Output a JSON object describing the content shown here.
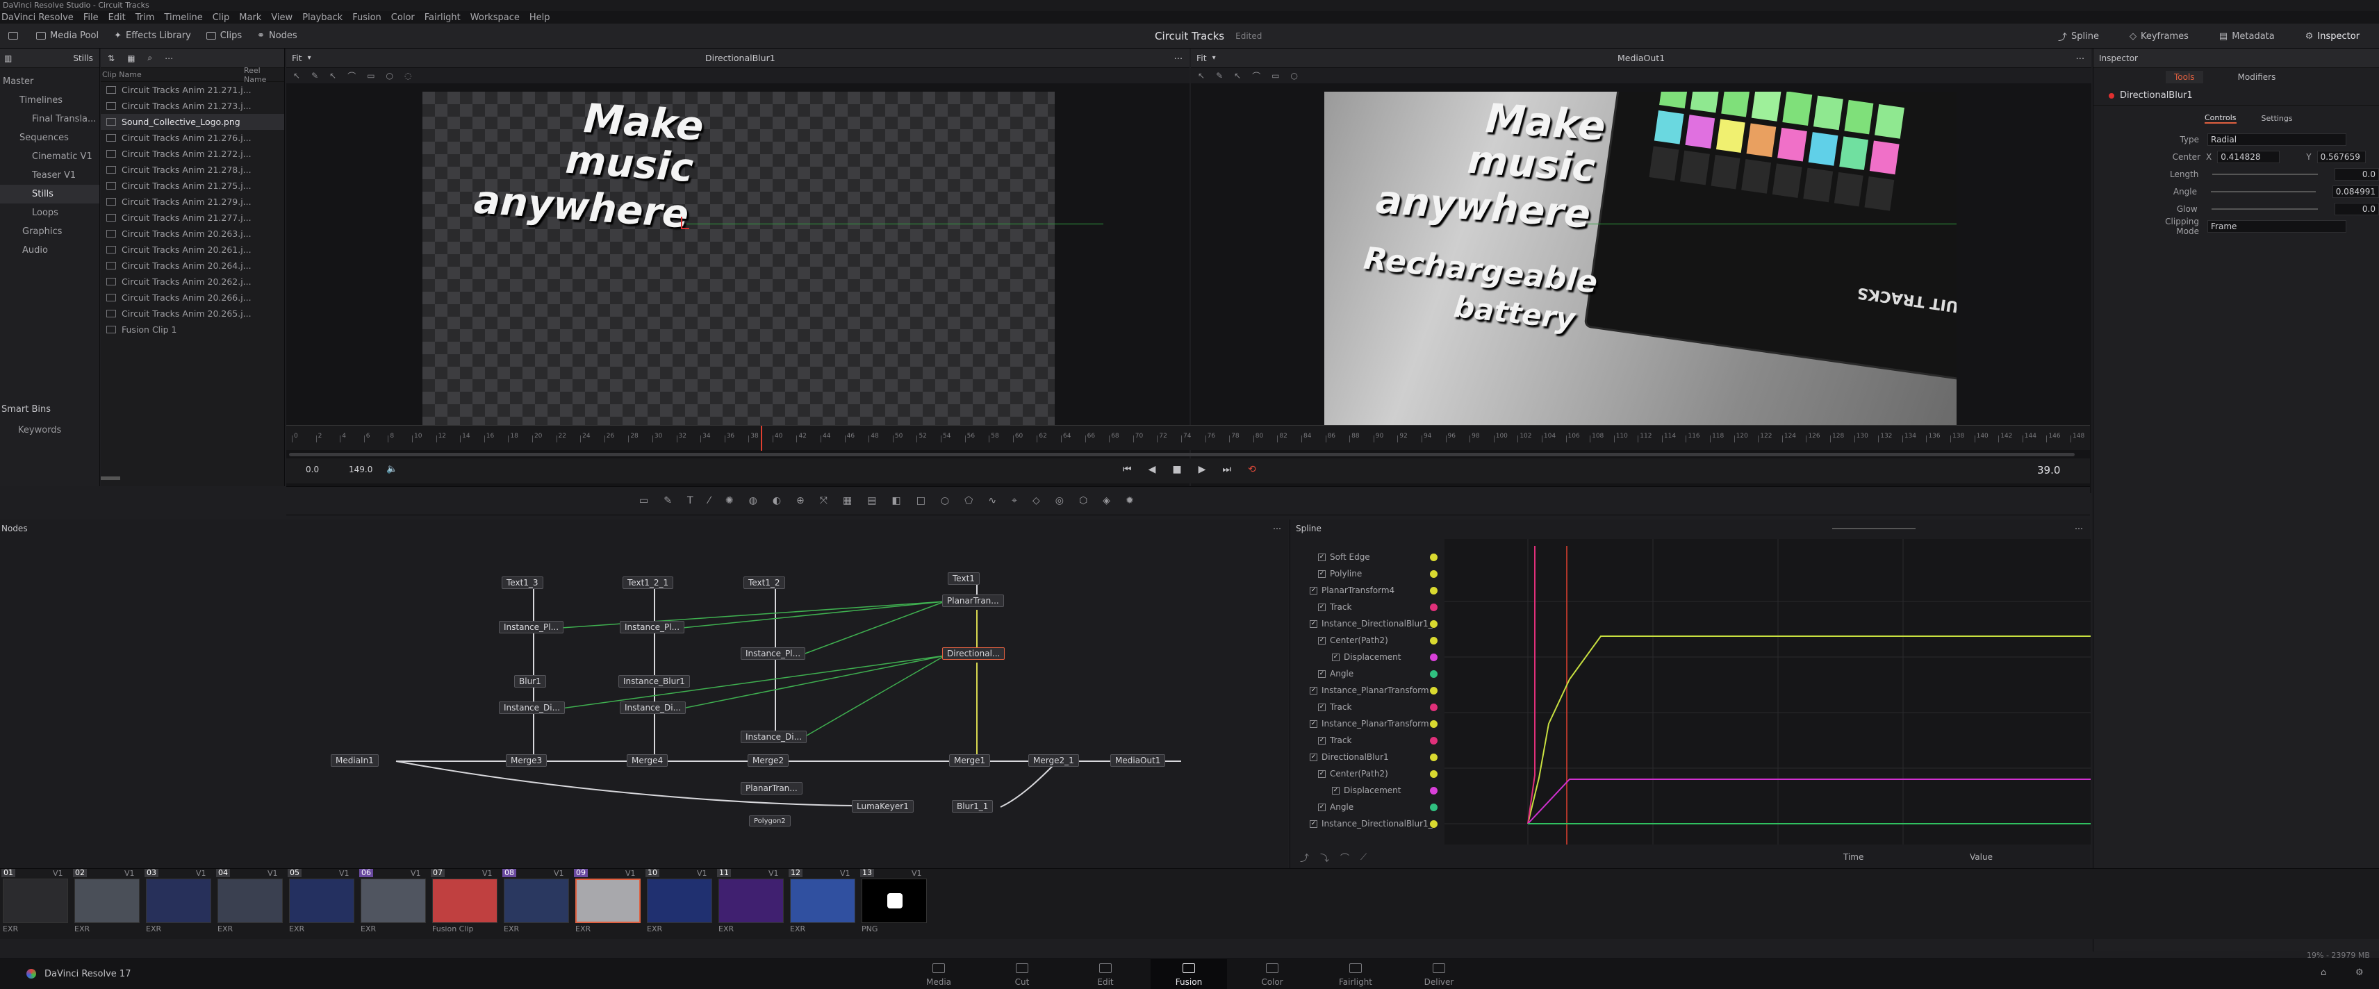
{
  "window": {
    "title": "DaVinci Resolve Studio - Circuit Tracks"
  },
  "menu": [
    "DaVinci Resolve",
    "File",
    "Edit",
    "Trim",
    "Timeline",
    "Clip",
    "Mark",
    "View",
    "Playback",
    "Fusion",
    "Color",
    "Fairlight",
    "Workspace",
    "Help"
  ],
  "toolbar": {
    "media_pool": "Media Pool",
    "effects_library": "Effects Library",
    "clips": "Clips",
    "nodes": "Nodes",
    "project_name": "Circuit Tracks",
    "edited": "Edited",
    "spline": "Spline",
    "keyframes": "Keyframes",
    "metadata": "Metadata",
    "inspector": "Inspector"
  },
  "media_pool": {
    "stills_label": "Stills",
    "tree": [
      "Master",
      "Timelines",
      "Final Transla...",
      "Sequences",
      "Cinematic V1",
      "Teaser V1",
      "Stills",
      "Loops",
      "Graphics",
      "Audio"
    ],
    "smart_bins": "Smart Bins",
    "keywords": "Keywords",
    "col_clip_name": "Clip Name",
    "col_reel_name": "Reel Name",
    "clips": [
      "Circuit Tracks Anim 21.271.j...",
      "Circuit Tracks Anim 21.273.j...",
      "Sound_Collective_Logo.png",
      "Circuit Tracks Anim 21.276.j...",
      "Circuit Tracks Anim 21.272.j...",
      "Circuit Tracks Anim 21.278.j...",
      "Circuit Tracks Anim 21.275.j...",
      "Circuit Tracks Anim 21.279.j...",
      "Circuit Tracks Anim 21.277.j...",
      "Circuit Tracks Anim 20.263.j...",
      "Circuit Tracks Anim 20.261.j...",
      "Circuit Tracks Anim 20.264.j...",
      "Circuit Tracks Anim 20.262.j...",
      "Circuit Tracks Anim 20.266.j...",
      "Circuit Tracks Anim 20.265.j...",
      "Fusion Clip 1"
    ]
  },
  "viewer_left": {
    "zoom": "Fit",
    "title": "DirectionalBlur1",
    "text1": "Make",
    "text2": "music",
    "text3": "anywhere"
  },
  "viewer_right": {
    "zoom": "Fit",
    "title": "MediaOut1",
    "text1": "Make",
    "text2": "music",
    "text3": "anywhere",
    "text4": "Rechargeable",
    "text5": "battery",
    "device_label": "UIT TRACKS"
  },
  "ruler": {
    "ticks": [
      "0",
      "2",
      "4",
      "6",
      "8",
      "10",
      "12",
      "14",
      "16",
      "18",
      "20",
      "22",
      "24",
      "26",
      "28",
      "30",
      "32",
      "34",
      "36",
      "38",
      "40",
      "42",
      "44",
      "46",
      "48",
      "50",
      "52",
      "54",
      "56",
      "58",
      "60",
      "62",
      "64",
      "66",
      "68",
      "70",
      "72",
      "74",
      "76",
      "78",
      "80",
      "82",
      "84",
      "86",
      "88",
      "90",
      "92",
      "94",
      "96",
      "98",
      "100",
      "102",
      "104",
      "106",
      "108",
      "110",
      "112",
      "114",
      "116",
      "118",
      "120",
      "122",
      "124",
      "126",
      "128",
      "130",
      "132",
      "134",
      "136",
      "138",
      "140",
      "142",
      "144",
      "146",
      "148"
    ]
  },
  "transport": {
    "start": "0.0",
    "end": "149.0",
    "current": "39.0"
  },
  "inspector": {
    "title": "Inspector",
    "tab_tools": "Tools",
    "tab_modifiers": "Modifiers",
    "node_name": "DirectionalBlur1",
    "sub_controls": "Controls",
    "sub_settings": "Settings",
    "type_label": "Type",
    "type_value": "Radial",
    "center_label": "Center",
    "x_label": "X",
    "center_x": "0.414828",
    "y_label": "Y",
    "center_y": "0.567659",
    "length_label": "Length",
    "length_value": "0.0",
    "angle_label": "Angle",
    "angle_value": "0.084991",
    "glow_label": "Glow",
    "glow_value": "0.0",
    "clipping_label": "Clipping Mode",
    "clipping_value": "Frame"
  },
  "nodes_panel": {
    "title": "Nodes",
    "nodes": {
      "text1_3": "Text1_3",
      "text1_2_1": "Text1_2_1",
      "text1_2": "Text1_2",
      "text1": "Text1",
      "inst_pl_a": "Instance_Pl...",
      "inst_pl_b": "Instance_Pl...",
      "planar4": "PlanarTran...",
      "inst_pl_c": "Instance_Pl...",
      "directional": "Directional...",
      "blur1": "Blur1",
      "inst_blur1": "Instance_Blur1",
      "inst_di_a": "Instance_Di...",
      "inst_di_b": "Instance_Di...",
      "inst_di_c": "Instance_Di...",
      "mediain": "MediaIn1",
      "merge3": "Merge3",
      "merge4": "Merge4",
      "merge2": "Merge2",
      "merge1": "Merge1",
      "merge2_1": "Merge2_1",
      "mediaout": "MediaOut1",
      "planar_b": "PlanarTran...",
      "polygon2": "Polygon2",
      "lumakeyer": "LumaKeyer1",
      "blur1_1": "Blur1_1"
    }
  },
  "spline_panel": {
    "title": "Spline",
    "items": [
      "Soft Edge",
      "Polyline",
      "PlanarTransform4",
      "Track",
      "Instance_DirectionalBlur1_",
      "Center(Path2)",
      "Displacement",
      "Angle",
      "Instance_PlanarTransform",
      "Track",
      "Instance_PlanarTransform",
      "Track",
      "DirectionalBlur1",
      "Center(Path2)",
      "Displacement",
      "Angle",
      "Instance_DirectionalBlur1_"
    ],
    "time_label": "Time",
    "value_label": "Value",
    "dot_colors": [
      "#d9d930",
      "#d9d930",
      "#d9d930",
      "#e0307a",
      "#d9d930",
      "#d9d930",
      "#d940d9",
      "#30c080",
      "#d9d930",
      "#e0307a",
      "#d9d930",
      "#e0307a",
      "#d9d930",
      "#d9d930",
      "#d940d9",
      "#30c080",
      "#d9d930"
    ]
  },
  "thumbnails": [
    {
      "num": "01",
      "v": "V1",
      "label": "EXR"
    },
    {
      "num": "02",
      "v": "V1",
      "label": "EXR"
    },
    {
      "num": "03",
      "v": "V1",
      "label": "EXR"
    },
    {
      "num": "04",
      "v": "V1",
      "label": "EXR"
    },
    {
      "num": "05",
      "v": "V1",
      "label": "EXR"
    },
    {
      "num": "06",
      "v": "V1",
      "label": "EXR"
    },
    {
      "num": "07",
      "v": "V1",
      "label": "Fusion Clip"
    },
    {
      "num": "08",
      "v": "V1",
      "label": "EXR"
    },
    {
      "num": "09",
      "v": "V1",
      "label": "EXR"
    },
    {
      "num": "10",
      "v": "V1",
      "label": "EXR"
    },
    {
      "num": "11",
      "v": "V1",
      "label": "EXR"
    },
    {
      "num": "12",
      "v": "V1",
      "label": "EXR"
    },
    {
      "num": "13",
      "v": "V1",
      "label": "PNG"
    }
  ],
  "pages": [
    "Media",
    "Cut",
    "Edit",
    "Fusion",
    "Color",
    "Fairlight",
    "Deliver"
  ],
  "app_name": "DaVinci Resolve 17",
  "status": "19% - 23979 MB",
  "colors": {
    "accent": "#e06040",
    "fusion_selected": "#e8e8ec",
    "curve_yellow": "#c8e040",
    "curve_pink": "#d030d0",
    "curve_green": "#30c060"
  }
}
